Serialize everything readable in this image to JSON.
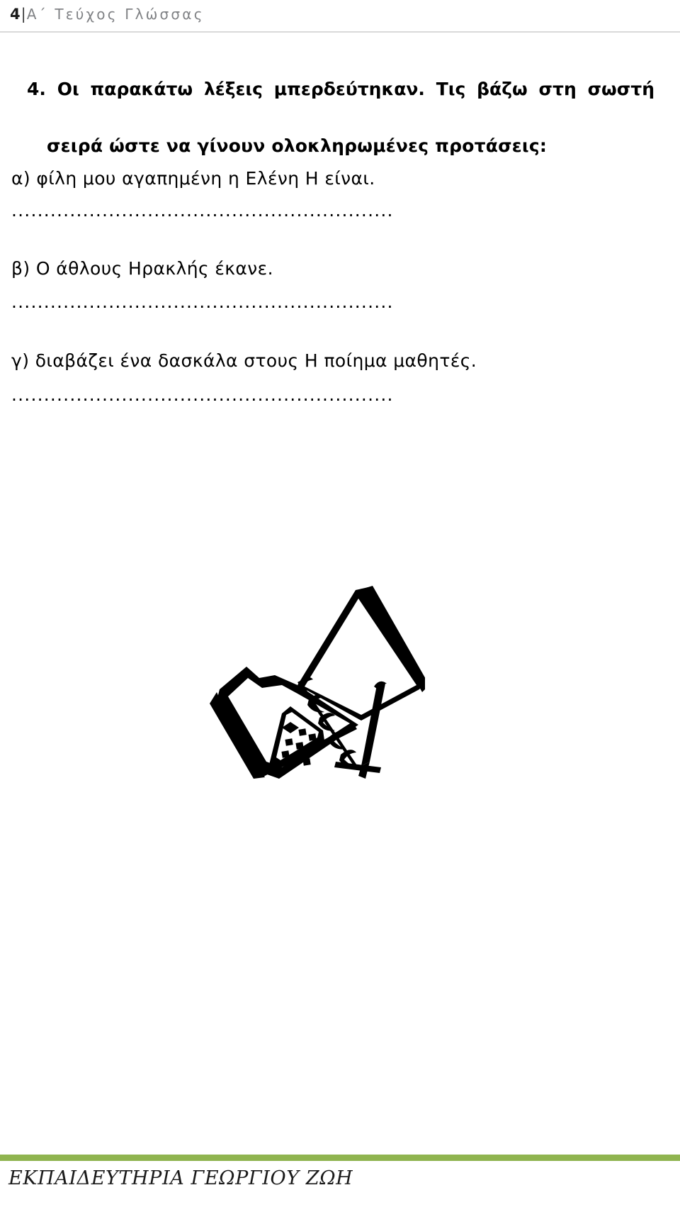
{
  "header": {
    "page_number": "4",
    "separator": "|",
    "title": "Α΄  Τεύχος  Γλώσσας"
  },
  "exercise": {
    "number": "4.",
    "prompt_line_1": "4. Οι παρακάτω λέξεις μπερδεύτηκαν. Τις βάζω στη σωστή",
    "prompt_line_2": "σειρά ώστε να γίνουν ολοκληρωμένες προτάσεις:",
    "items": [
      {
        "label": "α)",
        "text": "α) φίλη   μου   αγαπημένη   η   Ελένη  Η  είναι.",
        "answer_line": "..........................................................................."
      },
      {
        "label": "β)",
        "text": "β) Ο άθλους Ηρακλής έκανε.",
        "answer_line": "..........................................................................."
      },
      {
        "label": "γ)",
        "text": "γ) διαβάζει  ένα  δασκάλα  στους   Η  ποίημα  μαθητές.",
        "answer_line": "..........................................................................."
      }
    ]
  },
  "illustration": {
    "name": "open-notebook-calculator-pen-clipart",
    "description": "Black and white line drawing of an open spiral notebook with a calculator and a pen"
  },
  "footer": {
    "rule_color": "#8FB44F",
    "text": "ΕΚΠΑΙΔΕΥΤΗΡΙΑ ΓΕΩΡΓΙΟΥ ΖΩΗ"
  }
}
